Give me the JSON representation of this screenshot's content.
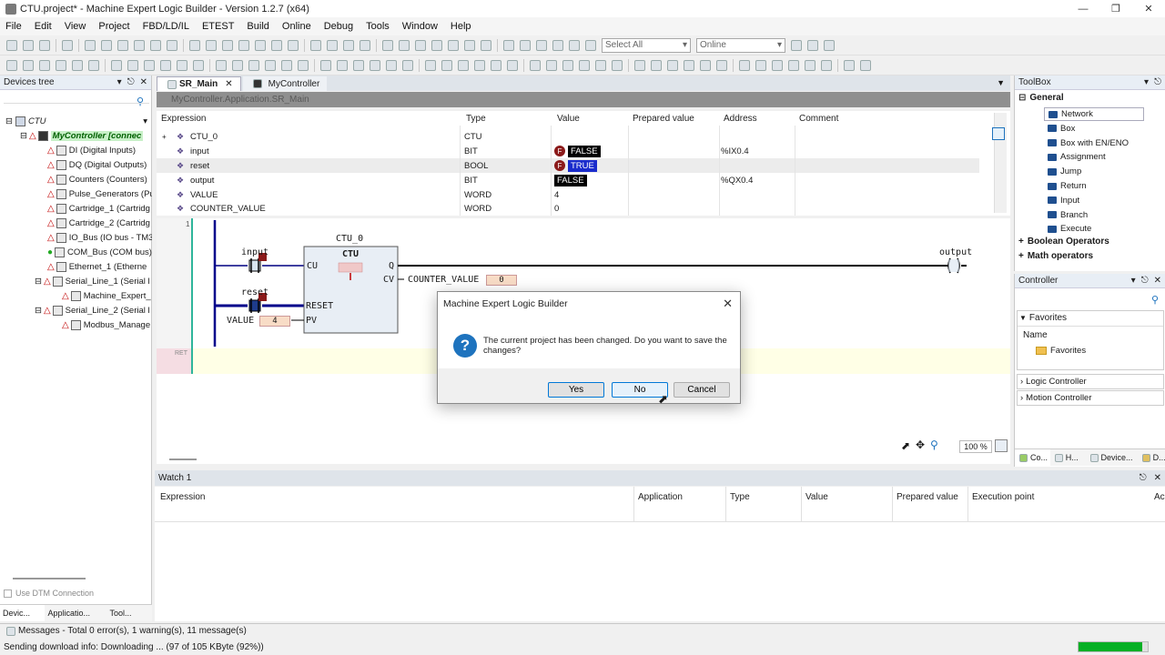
{
  "window": {
    "title": "CTU.project* - Machine Expert Logic Builder - Version 1.2.7 (x64)"
  },
  "menu": [
    "File",
    "Edit",
    "View",
    "Project",
    "FBD/LD/IL",
    "ETEST",
    "Build",
    "Online",
    "Debug",
    "Tools",
    "Window",
    "Help"
  ],
  "toolbar": {
    "select_combo": "Select All",
    "online_combo": "Online"
  },
  "devices_tree": {
    "title": "Devices tree",
    "root": "CTU",
    "controller": "MyController [connec",
    "items": [
      "DI (Digital Inputs)",
      "DQ (Digital Outputs)",
      "Counters (Counters)",
      "Pulse_Generators (Pu",
      "Cartridge_1 (Cartridg",
      "Cartridge_2 (Cartridg",
      "IO_Bus (IO bus - TM3",
      "COM_Bus (COM bus)",
      "Ethernet_1 (Etherne",
      "Serial_Line_1 (Serial l",
      "Machine_Expert_",
      "Serial_Line_2 (Serial l",
      "Modbus_Manage"
    ],
    "use_dtm": "Use DTM Connection",
    "bottom_tabs": [
      "Devic...",
      "Applicatio...",
      "Tool..."
    ]
  },
  "editor_tabs": {
    "active": "SR_Main",
    "inactive": "MyController"
  },
  "path": "MyController.Application.SR_Main",
  "var_table": {
    "headers": [
      "Expression",
      "Type",
      "Value",
      "Prepared value",
      "Address",
      "Comment"
    ],
    "rows": [
      {
        "expr": "CTU_0",
        "type": "CTU",
        "value": "",
        "address": ""
      },
      {
        "expr": "input",
        "type": "BIT",
        "value": "FALSE",
        "address": "%IX0.4"
      },
      {
        "expr": "reset",
        "type": "BOOL",
        "value": "TRUE",
        "address": ""
      },
      {
        "expr": "output",
        "type": "BIT",
        "value": "FALSE",
        "address": "%QX0.4"
      },
      {
        "expr": "VALUE",
        "type": "WORD",
        "value": "4",
        "address": ""
      },
      {
        "expr": "COUNTER_VALUE",
        "type": "WORD",
        "value": "0",
        "address": ""
      }
    ]
  },
  "ladder": {
    "network_no": "1",
    "fb_instance": "CTU_0",
    "fb_type": "CTU",
    "pin_cu": "CU",
    "pin_reset": "RESET",
    "pin_pv": "PV",
    "pin_q": "Q",
    "pin_cv": "CV",
    "contact_input": "input",
    "contact_reset": "reset",
    "pv_var": "VALUE",
    "pv_value": "4",
    "cv_var": "COUNTER_VALUE",
    "cv_value": "0",
    "coil_output": "output",
    "ret_label": "RET",
    "zoom": "100 %"
  },
  "watch": {
    "title": "Watch 1",
    "headers": [
      "Expression",
      "Application",
      "Type",
      "Value",
      "Prepared value",
      "Execution point",
      "Ac"
    ]
  },
  "toolbox": {
    "title": "ToolBox",
    "group_general": "General",
    "items": [
      "Network",
      "Box",
      "Box with EN/ENO",
      "Assignment",
      "Jump",
      "Return",
      "Input",
      "Branch",
      "Execute"
    ],
    "group_boolean": "Boolean Operators",
    "group_math": "Math operators"
  },
  "controller_panel": {
    "title": "Controller",
    "favorites_group": "Favorites",
    "name_col": "Name",
    "favorites_item": "Favorites",
    "logic_controller": "Logic Controller",
    "motion_controller": "Motion Controller",
    "bottom_tabs": [
      "Co...",
      "H...",
      "Device...",
      "D..."
    ]
  },
  "status": {
    "messages": "Messages - Total 0 error(s), 1 warning(s), 11 message(s)",
    "download": "Sending download info: Downloading ... (97 of 105 KByte (92%))",
    "progress": 0.92
  },
  "dialog": {
    "title": "Machine Expert Logic Builder",
    "message": "The current project has been changed. Do you want to save the changes?",
    "yes": "Yes",
    "no": "No",
    "cancel": "Cancel"
  }
}
